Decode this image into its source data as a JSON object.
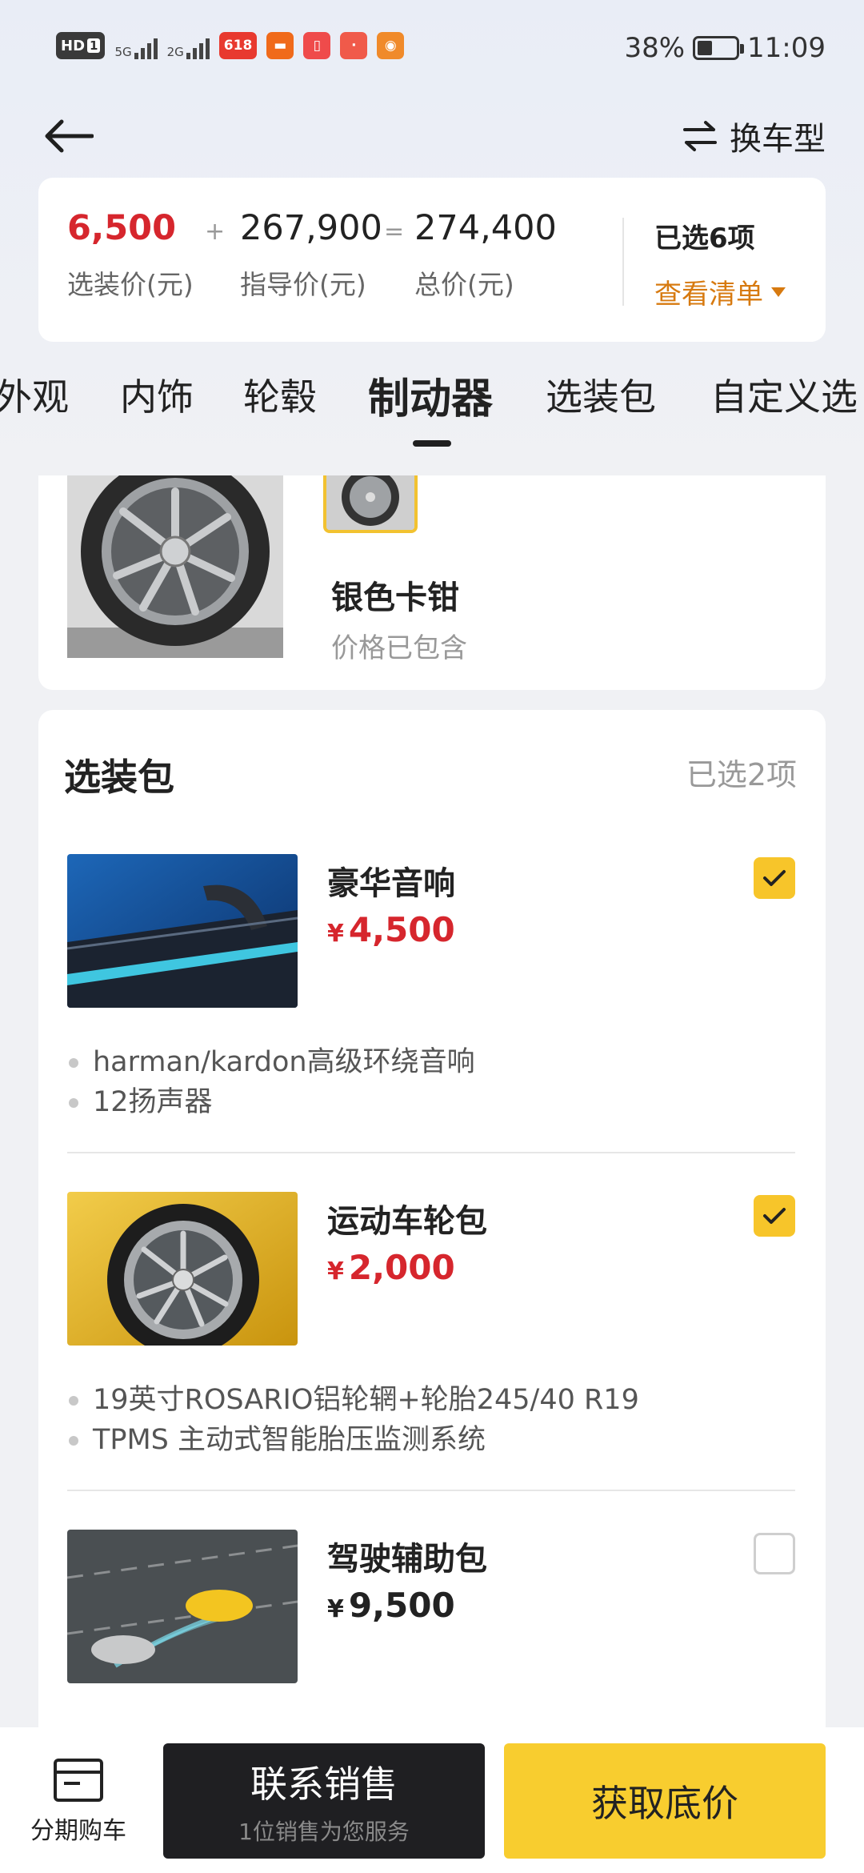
{
  "status_bar": {
    "hd_label": "HD",
    "hd_num": "1",
    "sig1_label": "5G",
    "sig2_label": "2G",
    "app_badge_label": "618",
    "battery_percent": "38%",
    "battery_level": 0.38,
    "time": "11:09"
  },
  "header": {
    "switch_label": "换车型"
  },
  "summary": {
    "option_price": "6,500",
    "option_label": "选装价(元)",
    "plus": "+",
    "guide_price": "267,900",
    "guide_label": "指导价(元)",
    "equals": "=",
    "total_price": "274,400",
    "total_label": "总价(元)",
    "selected": "已选6项",
    "view_list": "查看清单"
  },
  "tabs": [
    "外观",
    "内饰",
    "轮毂",
    "制动器",
    "选装包",
    "自定义选"
  ],
  "active_tab": "制动器",
  "brake": {
    "name": "银色卡钳",
    "price_note": "价格已包含"
  },
  "packages": {
    "title": "选装包",
    "count": "已选2项",
    "items": [
      {
        "name": "豪华音响",
        "currency": "¥",
        "price": "4,500",
        "checked": true,
        "features": [
          "harman/kardon高级环绕音响",
          "12扬声器"
        ]
      },
      {
        "name": "运动车轮包",
        "currency": "¥",
        "price": "2,000",
        "checked": true,
        "features": [
          "19英寸ROSARIO铝轮辋+轮胎245/40 R19",
          "TPMS 主动式智能胎压监测系统"
        ]
      },
      {
        "name": "驾驶辅助包",
        "currency": "¥",
        "price": "9,500",
        "checked": false,
        "features": []
      }
    ]
  },
  "bottom": {
    "installment_label": "分期购车",
    "contact_main": "联系销售",
    "contact_sub": "1位销售为您服务",
    "quote_label": "获取底价"
  },
  "colors": {
    "accent_yellow": "#f8cd2f",
    "price_red": "#d6262d",
    "link_orange": "#d77a10",
    "dark_button": "#1f1f22"
  }
}
